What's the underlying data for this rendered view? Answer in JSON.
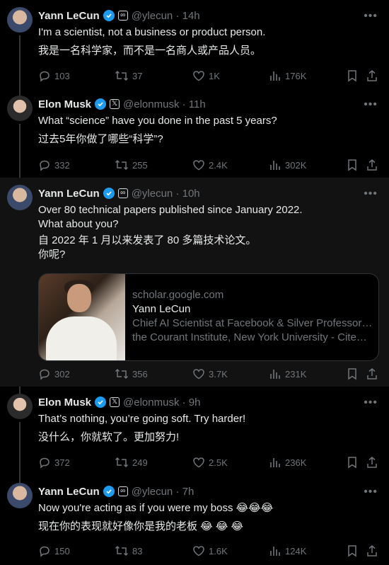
{
  "tweets": [
    {
      "author": "Yann LeCun",
      "handle": "@ylecun · 14h",
      "affiliation_icon": "meta-badge",
      "text_en": "I'm a scientist, not a business or product person.",
      "text_zh": "我是一名科学家，而不是一名商人或产品人员。",
      "replies": "103",
      "reposts": "37",
      "likes": "1K",
      "views": "176K"
    },
    {
      "author": "Elon Musk",
      "handle": "@elonmusk · 11h",
      "affiliation_icon": "x-badge",
      "text_en": "What “science” have you done in the past 5 years?",
      "text_zh": "过去5年你做了哪些“科学”?",
      "replies": "332",
      "reposts": "255",
      "likes": "2.4K",
      "views": "302K"
    },
    {
      "author": "Yann LeCun",
      "handle": "@ylecun · 10h",
      "affiliation_icon": "meta-badge",
      "text_en": "Over 80 technical papers published since January 2022.\nWhat about you?",
      "text_zh": "自 2022 年 1 月以来发表了 80 多篇技术论文。\n你呢?",
      "card": {
        "domain": "scholar.google.com",
        "title": "Yann LeCun",
        "desc_line1": "Chief AI Scientist at Facebook & Silver Professor at",
        "desc_line2": "the Courant Institute, New York University - Cited b..."
      },
      "replies": "302",
      "reposts": "356",
      "likes": "3.7K",
      "views": "231K"
    },
    {
      "author": "Elon Musk",
      "handle": "@elonmusk · 9h",
      "affiliation_icon": "x-badge",
      "text_en": "That’s nothing, you’re going soft. Try harder!",
      "text_zh": "没什么，你就软了。更加努力!",
      "replies": "372",
      "reposts": "249",
      "likes": "2.5K",
      "views": "236K"
    },
    {
      "author": "Yann LeCun",
      "handle": "@ylecun · 7h",
      "affiliation_icon": "meta-badge",
      "text_en": "Now you're acting as if you were my boss 😂😂😂",
      "text_zh": "现在你的表现就好像你是我的老板 😂  😂  😂",
      "replies": "150",
      "reposts": "83",
      "likes": "1.6K",
      "views": "124K"
    }
  ],
  "colors": {
    "accent": "#1d9bf0",
    "muted": "#71767b",
    "text": "#e7e9ea",
    "background": "#000000"
  }
}
